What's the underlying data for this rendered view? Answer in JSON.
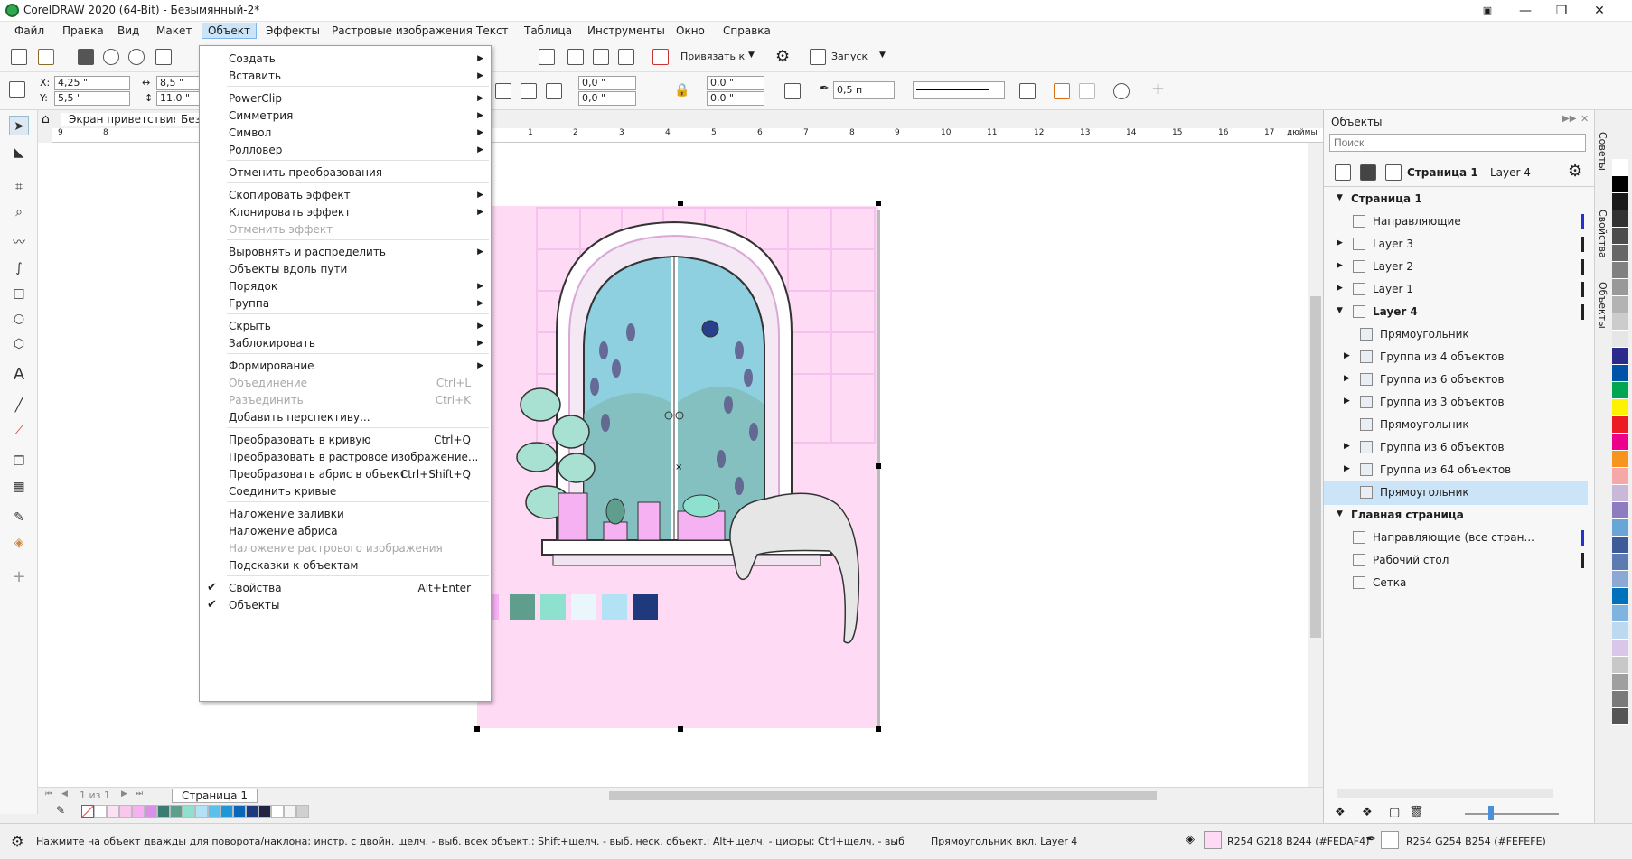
{
  "window": {
    "title": "CorelDRAW 2020 (64-Bit) - Безымянный-2*",
    "min": "—",
    "restore": "❐",
    "close": "✕"
  },
  "menubar": [
    "Файл",
    "Правка",
    "Вид",
    "Макет",
    "Объект",
    "Эффекты",
    "Растровые изображения",
    "Текст",
    "Таблица",
    "Инструменты",
    "Окно",
    "Справка"
  ],
  "toolbar": {
    "snap_label": "Привязать к",
    "launch_label": "Запуск",
    "x_label": "X:",
    "x_value": "4,25 \"",
    "y_label": "Y:",
    "y_value": "5,5 \"",
    "w_value": "8,5 \"",
    "h_value": "11,0 \"",
    "angle1": "0,0 \"",
    "angle2": "0,0 \"",
    "angle3": "0,0 \"",
    "angle4": "0,0 \"",
    "outline_width": "0,5 п"
  },
  "doc_tabs": {
    "welcome": "Экран приветствия",
    "doc": "Безы"
  },
  "ruler": {
    "h_ticks": [
      "9",
      "8",
      "1",
      "2",
      "3",
      "4",
      "5",
      "6",
      "7",
      "8",
      "9",
      "10",
      "11",
      "12",
      "13",
      "14",
      "15",
      "16",
      "17"
    ],
    "unit": "дюймы"
  },
  "object_menu": {
    "items": [
      {
        "label": "Создать",
        "sub": true
      },
      {
        "label": "Вставить",
        "sub": true
      },
      {
        "sep": true
      },
      {
        "label": "PowerClip",
        "sub": true
      },
      {
        "label": "Симметрия",
        "sub": true
      },
      {
        "label": "Символ",
        "sub": true
      },
      {
        "label": "Ролловер",
        "sub": true
      },
      {
        "sep": true
      },
      {
        "label": "Отменить преобразования"
      },
      {
        "sep": true
      },
      {
        "label": "Скопировать эффект",
        "sub": true
      },
      {
        "label": "Клонировать эффект",
        "sub": true
      },
      {
        "label": "Отменить эффект",
        "disabled": true
      },
      {
        "sep": true
      },
      {
        "label": "Выровнять и распределить",
        "sub": true
      },
      {
        "label": "Объекты вдоль пути"
      },
      {
        "label": "Порядок",
        "sub": true
      },
      {
        "label": "Группа",
        "sub": true
      },
      {
        "sep": true
      },
      {
        "label": "Скрыть",
        "sub": true
      },
      {
        "label": "Заблокировать",
        "sub": true
      },
      {
        "sep": true
      },
      {
        "label": "Формирование",
        "sub": true
      },
      {
        "label": "Объединение",
        "shortcut": "Ctrl+L",
        "disabled": true
      },
      {
        "label": "Разъединить",
        "shortcut": "Ctrl+K",
        "disabled": true
      },
      {
        "label": "Добавить перспективу..."
      },
      {
        "sep": true
      },
      {
        "label": "Преобразовать в кривую",
        "shortcut": "Ctrl+Q"
      },
      {
        "label": "Преобразовать в растровое изображение..."
      },
      {
        "label": "Преобразовать абрис в объект",
        "shortcut": "Ctrl+Shift+Q"
      },
      {
        "label": "Соединить кривые"
      },
      {
        "sep": true
      },
      {
        "label": "Наложение заливки"
      },
      {
        "label": "Наложение абриса"
      },
      {
        "label": "Наложение растрового изображения",
        "disabled": true
      },
      {
        "label": "Подсказки к объектам"
      },
      {
        "sep": true
      },
      {
        "label": "Свойства",
        "shortcut": "Alt+Enter",
        "checked": true
      },
      {
        "label": "Объекты",
        "checked": true
      }
    ]
  },
  "page_nav": {
    "count": "1 из 1",
    "page_tab": "Страница 1"
  },
  "objects_panel": {
    "title": "Объекты",
    "search_placeholder": "Поиск",
    "page_label": "Страница 1",
    "layer_label": "Layer 4",
    "rows": [
      {
        "label": "Страница 1",
        "indent": 0,
        "bold": true,
        "tri": "▼",
        "icon": ""
      },
      {
        "label": "Направляющие",
        "indent": 1,
        "tri": "",
        "icon": "guides-icon",
        "bar": "#2233cc"
      },
      {
        "label": "Layer 3",
        "indent": 1,
        "tri": "▶",
        "icon": "layer-icon",
        "bar": "#222"
      },
      {
        "label": "Layer 2",
        "indent": 1,
        "tri": "▶",
        "icon": "layer-icon",
        "bar": "#222"
      },
      {
        "label": "Layer 1",
        "indent": 1,
        "tri": "▶",
        "icon": "layer-icon",
        "bar": "#222"
      },
      {
        "label": "Layer 4",
        "indent": 1,
        "bold": true,
        "tri": "▼",
        "icon": "layer-icon",
        "bar": "#222"
      },
      {
        "label": "Прямоугольник",
        "indent": 2,
        "tri": "",
        "icon": "thumb-icon"
      },
      {
        "label": "Группа из 4 объектов",
        "indent": 2,
        "tri": "▶",
        "icon": "thumb-icon"
      },
      {
        "label": "Группа из 6 объектов",
        "indent": 2,
        "tri": "▶",
        "icon": "thumb-icon"
      },
      {
        "label": "Группа из 3 объектов",
        "indent": 2,
        "tri": "▶",
        "icon": "thumb-icon"
      },
      {
        "label": "Прямоугольник",
        "indent": 2,
        "tri": "",
        "icon": "thumb-icon"
      },
      {
        "label": "Группа из 6 объектов",
        "indent": 2,
        "tri": "▶",
        "icon": "thumb-icon"
      },
      {
        "label": "Группа из 64 объектов",
        "indent": 2,
        "tri": "▶",
        "icon": "thumb-icon"
      },
      {
        "label": "Прямоугольник",
        "indent": 2,
        "tri": "",
        "icon": "thumb-icon",
        "selected": true
      },
      {
        "label": "Главная страница",
        "indent": 0,
        "bold": true,
        "tri": "▼",
        "icon": ""
      },
      {
        "label": "Направляющие (все стран...",
        "indent": 1,
        "tri": "",
        "icon": "guides-icon",
        "bar": "#2233cc"
      },
      {
        "label": "Рабочий стол",
        "indent": 1,
        "tri": "",
        "icon": "desktop-icon",
        "bar": "#222"
      },
      {
        "label": "Сетка",
        "indent": 1,
        "tri": "",
        "icon": "grid-icon"
      }
    ]
  },
  "side_tabs": [
    "Советы",
    "Свойства",
    "Объекты"
  ],
  "status": {
    "hint": "Нажмите на объект дважды для поворота/наклона; инстр. с двойн. щелч. - выб. всех объект.; Shift+щелч. - выб. неск. объект.; Alt+щелч. - цифры; Ctrl+щелч. - выб. в группе",
    "selection": "Прямоугольник вкл. Layer 4",
    "fill": "R254 G218 B244 (#FEDAF4)",
    "outline": "R254 G254 B254 (#FEFEFE)"
  },
  "colors": {
    "accent": "#0078d7",
    "menu_highlight": "#cce4f7",
    "page_pink": "#fedaf4",
    "selected_row": "#cce4f7"
  },
  "doc_palette": [
    "#f5b1f2",
    "#5f9e8c",
    "#8ee0cf",
    "#e9f6fb",
    "#b4e2f5",
    "#1e3a7c"
  ],
  "palette_bar": [
    "#ffffff",
    "#fde0f3",
    "#f9c6ee",
    "#f5b1f2",
    "#d990e8",
    "#3b7c72",
    "#5f9e8c",
    "#8ee0cf",
    "#b4e2f5",
    "#5bc0eb",
    "#1e96d8",
    "#0c66b8",
    "#1e3a7c",
    "#222244",
    "#ffffff",
    "#f4f4f4",
    "#d0d0d0"
  ],
  "side_palette": [
    "#ffffff",
    "#000000",
    "#1a1a1a",
    "#333333",
    "#4d4d4d",
    "#666666",
    "#808080",
    "#999999",
    "#b3b3b3",
    "#cccccc",
    "#e6e6e6",
    "#2b2b8c",
    "#0051a8",
    "#00a651",
    "#fff200",
    "#ed1c24",
    "#ec008c",
    "#f7941d",
    "#f6a8a8",
    "#c9b8d8",
    "#8e7cc3",
    "#6aa5d8",
    "#3d5a99",
    "#5b7bb1",
    "#8ca8d4",
    "#0072bc",
    "#7fb3e0",
    "#bdd9f0",
    "#d9c6e8",
    "#c8c8c8",
    "#9f9f9f",
    "#7a7a7a",
    "#555555"
  ]
}
